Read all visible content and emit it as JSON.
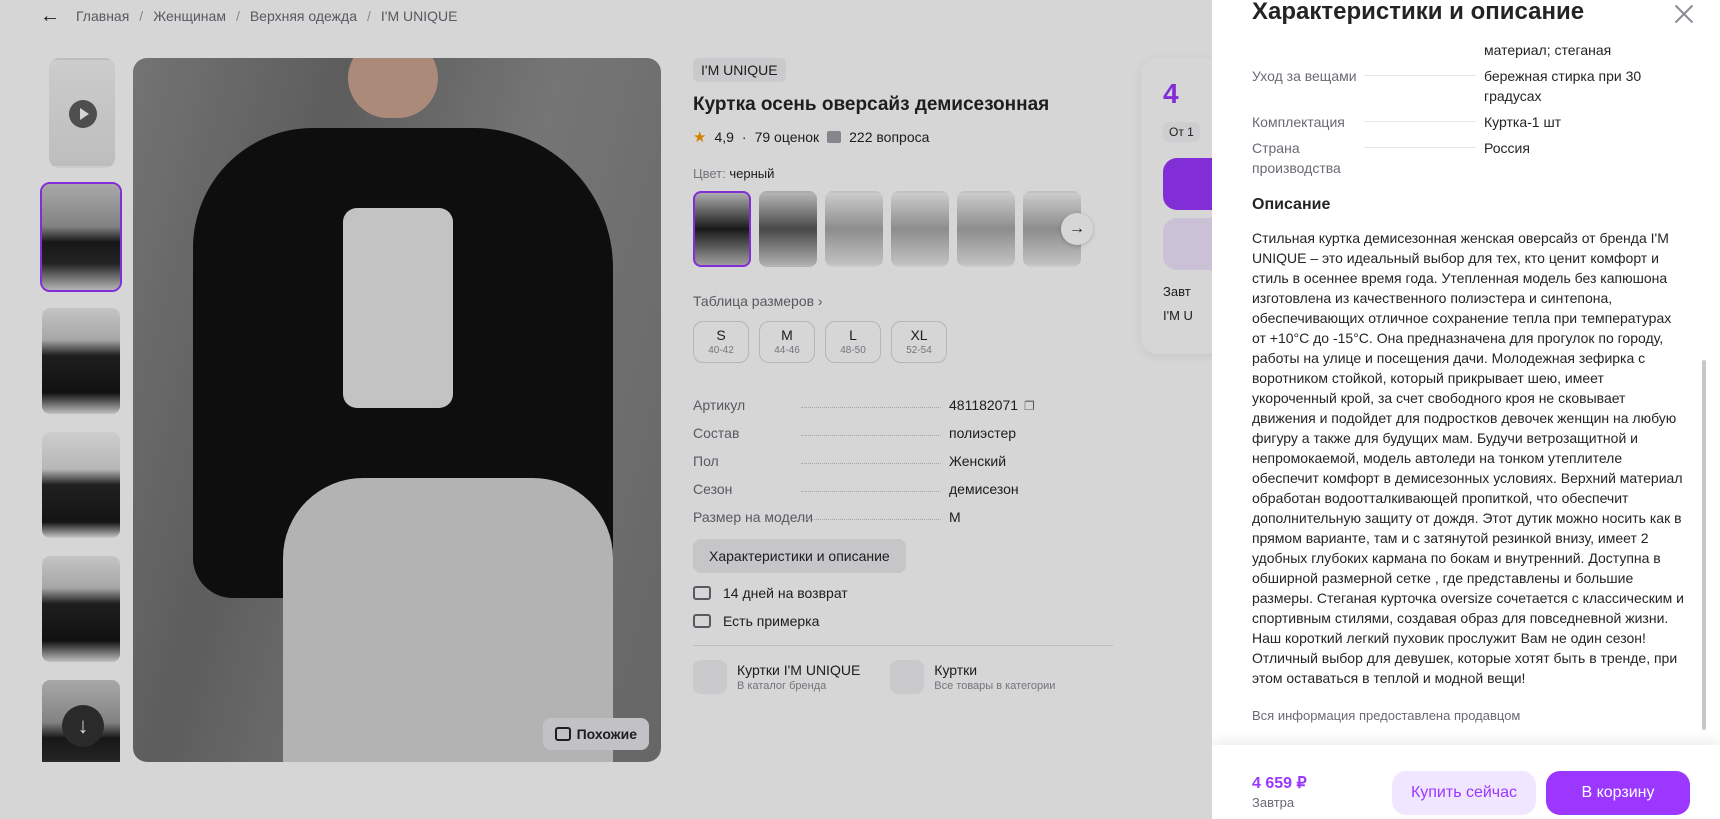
{
  "breadcrumb": {
    "items": [
      "Главная",
      "Женщинам",
      "Верхняя одежда",
      "I'M UNIQUE"
    ]
  },
  "product": {
    "brand": "I'M UNIQUE",
    "title": "Куртка осень оверсайз демисезонная",
    "rating": "4,9",
    "reviews": "79 оценок",
    "questions": "222 вопроса",
    "color_label": "Цвет:",
    "color_value": "черный",
    "size_table_link": "Таблица размеров",
    "sizes": [
      {
        "size": "S",
        "range": "40-42"
      },
      {
        "size": "M",
        "range": "44-46"
      },
      {
        "size": "L",
        "range": "48-50"
      },
      {
        "size": "XL",
        "range": "52-54"
      }
    ],
    "specs": [
      {
        "key": "Артикул",
        "value": "481182071"
      },
      {
        "key": "Состав",
        "value": "полиэстер"
      },
      {
        "key": "Пол",
        "value": "Женский"
      },
      {
        "key": "Сезон",
        "value": "демисезон"
      },
      {
        "key": "Размер на модели",
        "value": "M"
      }
    ],
    "characteristics_button": "Характеристики и описание",
    "features": [
      "14 дней на возврат",
      "Есть примерка"
    ],
    "similar_button": "Похожие",
    "links": [
      {
        "title": "Куртки I'M UNIQUE",
        "subtitle": "В каталог бренда"
      },
      {
        "title": "Куртки",
        "subtitle": "Все товары в категории"
      }
    ]
  },
  "price_card": {
    "price_partial": "4",
    "badge_partial": "От 1",
    "row1_partial": "Завт",
    "row2_partial": "I'M U"
  },
  "panel": {
    "title": "Характеристики и описание",
    "partial_row_value": "материал; стеганая",
    "rows": [
      {
        "key": "Уход за вещами",
        "value": "бережная стирка при 30 градусах"
      },
      {
        "key": "Комплектация",
        "value": "Куртка-1 шт"
      },
      {
        "key": "Страна производства",
        "value": "Россия"
      }
    ],
    "description_heading": "Описание",
    "description": "Стильная куртка демисезонная женская оверсайз от бренда I'M UNIQUE – это идеальный выбор для тех, кто ценит комфорт и стиль в осеннее время года. Утепленная модель без капюшона изготовлена из качественного полиэстера и синтепона, обеспечивающих отличное сохранение тепла при температурах от +10°С до -15°С. Она предназначена для прогулок по городу, работы на улице и посещения дачи. Молодежная зефирка с воротником стойкой, который прикрывает шею, имеет укороченный крой, за счет свободного кроя не сковывает движения и подойдет для подростков девочек женщин на любую фигуру а также для будущих мам. Будучи ветрозащитной и непромокаемой, модель автоледи на тонком утеплителе обеспечит комфорт в демисезонных условиях. Верхний материал обработан водоотталкивающей пропиткой, что обеспечит дополнительную защиту от дождя. Этот дутик можно носить как в прямом варианте, там и с затянутой резинкой внизу, имеет 2 удобных глубоких кармана по бокам и внутренний. Доступна в обширной размерной сетке , где представлены и большие размеры. Стеганая курточка oversize сочетается с классическим и спортивным стилями, создавая образ для повседневной жизни. Наш короткий легкий пуховик прослужит Вам не один сезон! Отличный выбор для девушек, которые хотят быть в тренде, при этом оставаться в теплой и модной вещи!",
    "seller_note": "Вся информация предоставлена продавцом",
    "footer": {
      "price": "4 659 ₽",
      "delivery": "Завтра",
      "buy_now": "Купить сейчас",
      "add_to_cart": "В корзину"
    }
  },
  "colors": {
    "accent": "#9b37ff",
    "accent_light": "#f1e6ff"
  }
}
